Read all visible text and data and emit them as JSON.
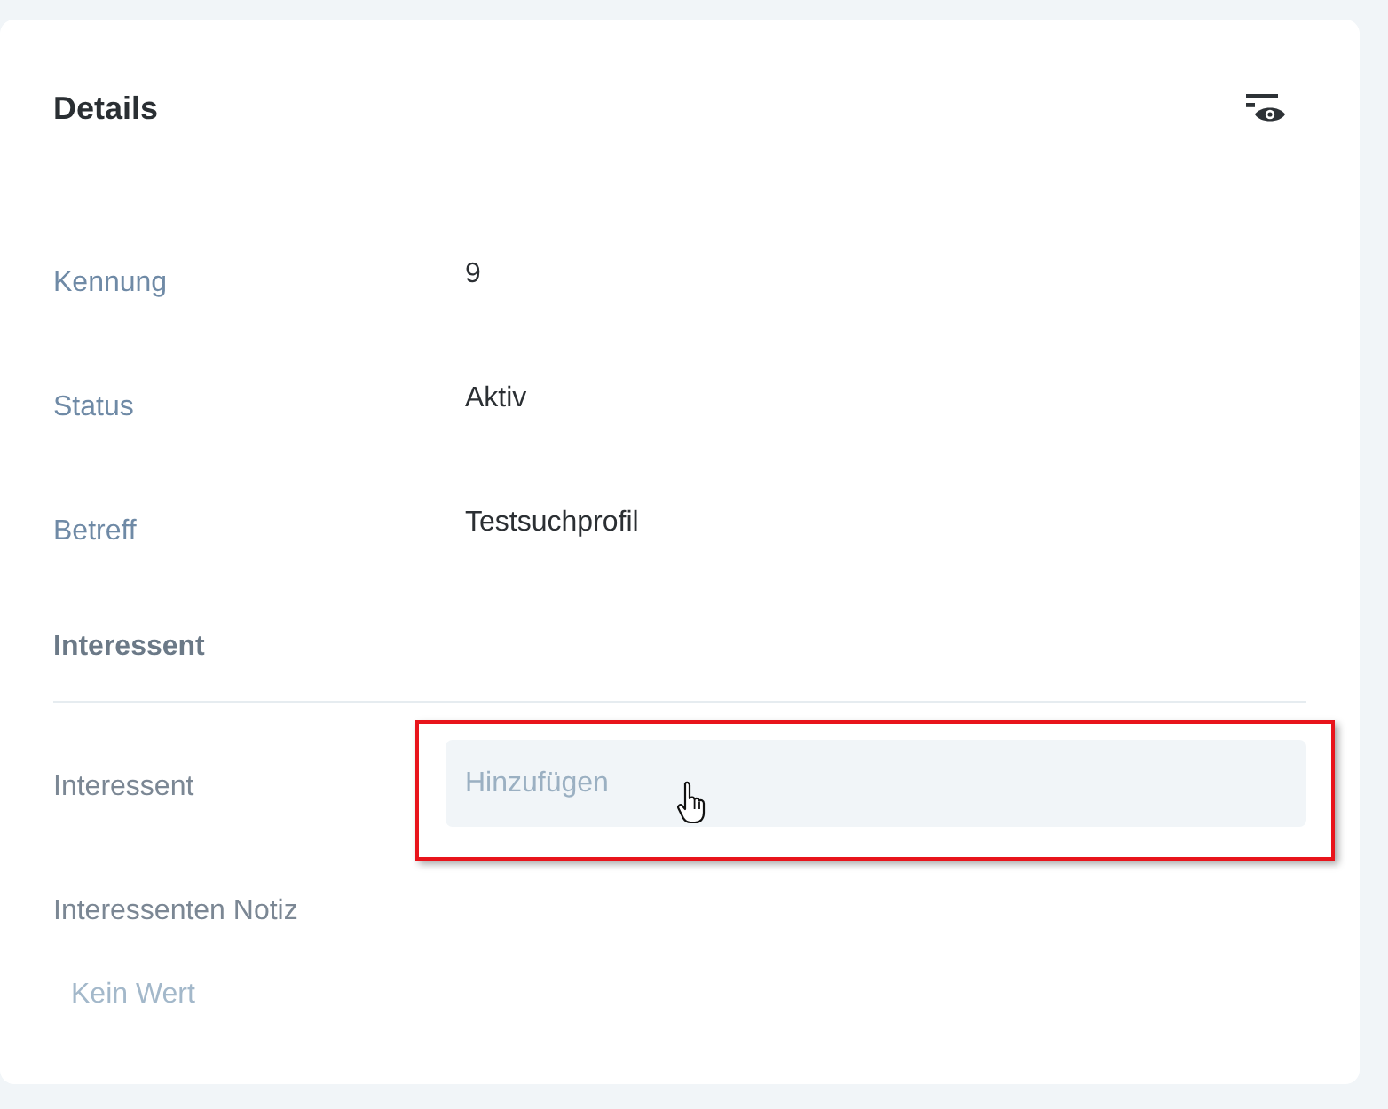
{
  "card": {
    "title": "Details"
  },
  "fields": [
    {
      "label": "Kennung",
      "value": "9"
    },
    {
      "label": "Status",
      "value": "Aktiv"
    },
    {
      "label": "Betreff",
      "value": "Testsuchprofil"
    }
  ],
  "section": {
    "title": "Interessent",
    "fields": [
      {
        "kind": "picker",
        "label": "Interessent",
        "placeholder": "Hinzufügen",
        "highlighted": true
      },
      {
        "kind": "note",
        "label": "Interessenten Notiz",
        "empty_text": "Kein Wert"
      }
    ]
  }
}
